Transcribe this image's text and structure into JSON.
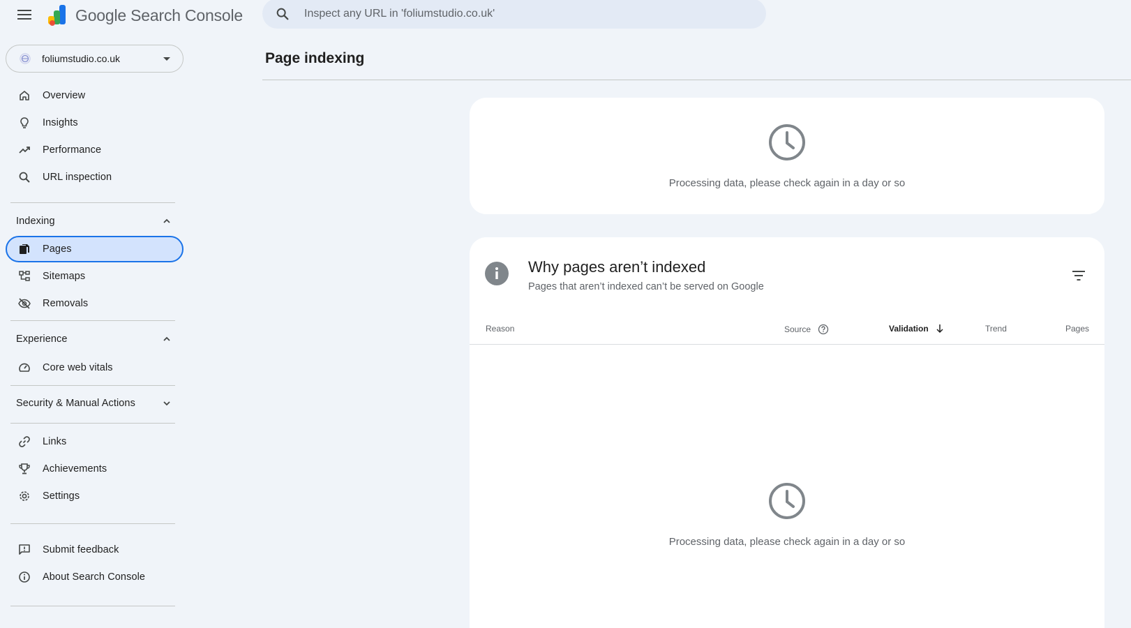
{
  "header": {
    "app_name": "Google Search Console",
    "search_placeholder": "Inspect any URL in 'foliumstudio.co.uk'"
  },
  "sidebar": {
    "property": "foliumstudio.co.uk",
    "items_top": [
      {
        "label": "Overview",
        "icon": "home-icon"
      },
      {
        "label": "Insights",
        "icon": "lightbulb-icon"
      },
      {
        "label": "Performance",
        "icon": "trending-up-icon"
      },
      {
        "label": "URL inspection",
        "icon": "search-icon"
      }
    ],
    "sections": {
      "indexing": {
        "label": "Indexing",
        "expanded": true
      },
      "experience": {
        "label": "Experience",
        "expanded": true
      },
      "security": {
        "label": "Security & Manual Actions",
        "expanded": false
      }
    },
    "indexing_items": [
      {
        "label": "Pages",
        "icon": "pages-icon",
        "active": true
      },
      {
        "label": "Sitemaps",
        "icon": "sitemap-icon"
      },
      {
        "label": "Removals",
        "icon": "visibility-off-icon"
      }
    ],
    "experience_items": [
      {
        "label": "Core web vitals",
        "icon": "speed-icon"
      }
    ],
    "other_items": [
      {
        "label": "Links",
        "icon": "link-icon"
      },
      {
        "label": "Achievements",
        "icon": "trophy-icon"
      },
      {
        "label": "Settings",
        "icon": "gear-icon"
      }
    ],
    "footer_items": [
      {
        "label": "Submit feedback",
        "icon": "feedback-icon"
      },
      {
        "label": "About Search Console",
        "icon": "info-icon"
      }
    ]
  },
  "main": {
    "title": "Page indexing",
    "processing_message": "Processing data, please check again in a day or so",
    "not_indexed": {
      "title": "Why pages aren’t indexed",
      "subtitle": "Pages that aren’t indexed can’t be served on Google",
      "columns": {
        "reason": "Reason",
        "source": "Source",
        "validation": "Validation",
        "trend": "Trend",
        "pages": "Pages"
      }
    }
  },
  "colors": {
    "background": "#f0f4f9",
    "active_bg": "#d3e3fd",
    "active_border": "#1a73e8",
    "text": "#1f1f1f",
    "muted": "#5f6368"
  }
}
